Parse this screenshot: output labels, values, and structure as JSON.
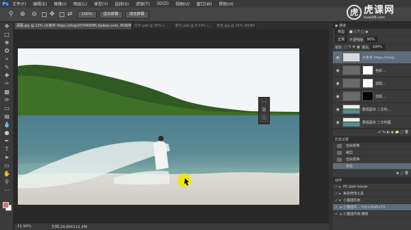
{
  "menubar": {
    "logo": "Ps",
    "items": [
      "文件(F)",
      "编辑(E)",
      "图像(I)",
      "图层(L)",
      "类型(Y)",
      "选择(S)",
      "滤镜(T)",
      "3D(D)",
      "视图(V)",
      "窗口(W)",
      "帮助(H)"
    ]
  },
  "brand": {
    "cn": "虎课网",
    "url": "huke88.com"
  },
  "options": {
    "zoom_pct": "100%",
    "fit_screen": "适合屏幕",
    "fill_screen": "填充屏幕"
  },
  "tabs": [
    {
      "label": "源图.jpg @ 22% (大象材 https://shop107049085.taobao.com, RGB/8*)",
      "active": true
    },
    {
      "label": "文字.psb @ 25% (...",
      "active": false
    },
    {
      "label": "新付.psb @ 8.33% (...",
      "active": false
    },
    {
      "label": "天空.jpg @ 25% (RGB/8...",
      "active": false
    }
  ],
  "statusbar": {
    "zoom": "21.99%",
    "doc": "文档:29.6M/111.8M"
  },
  "panels": {
    "top_tab": "通道",
    "filter_kind": "类型",
    "blend_mode": "正常",
    "opacity_label": "不透明度:",
    "opacity_value": "90%",
    "lock_label": "锁定:",
    "fill_label": "填充:",
    "fill_value": "100%",
    "layers": [
      {
        "name": "大象材 https://shop...",
        "thumb": "#d8d8d8",
        "mask": "",
        "selected": true
      },
      {
        "name": "色彩...",
        "thumb": "#7a7a7a",
        "mask": "#ffffff",
        "selected": false
      },
      {
        "name": "选取...",
        "thumb": "#7a7a7a",
        "mask": "#ffffff",
        "selected": false
      },
      {
        "name": "选取...",
        "thumb": "#7a7a7a",
        "mask": "#000000",
        "selected": false
      },
      {
        "name": "群组副本 二次构...",
        "thumb": "#4d6e8a",
        "mask": "",
        "selected": false
      },
      {
        "name": "群组副本 二次构图",
        "thumb": "#4d6e8a",
        "mask": "",
        "selected": false
      }
    ],
    "history_tab": "历史记录",
    "history": [
      {
        "label": "自由变换",
        "selected": false
      },
      {
        "label": "裁剪",
        "selected": false
      },
      {
        "label": "自由变换",
        "selected": false
      },
      {
        "label": "液化",
        "selected": true
      }
    ],
    "actions_tab": "动作",
    "actions": [
      {
        "label": "PS dark house",
        "selected": false
      },
      {
        "label": "美容修饰工具",
        "selected": false
      },
      {
        "label": "小猫插件用",
        "selected": false
      },
      {
        "label": "小猫插件... Ctrl+Shift+F2",
        "selected": true
      },
      {
        "label": "小猫插件用 精修",
        "selected": false
      }
    ]
  }
}
